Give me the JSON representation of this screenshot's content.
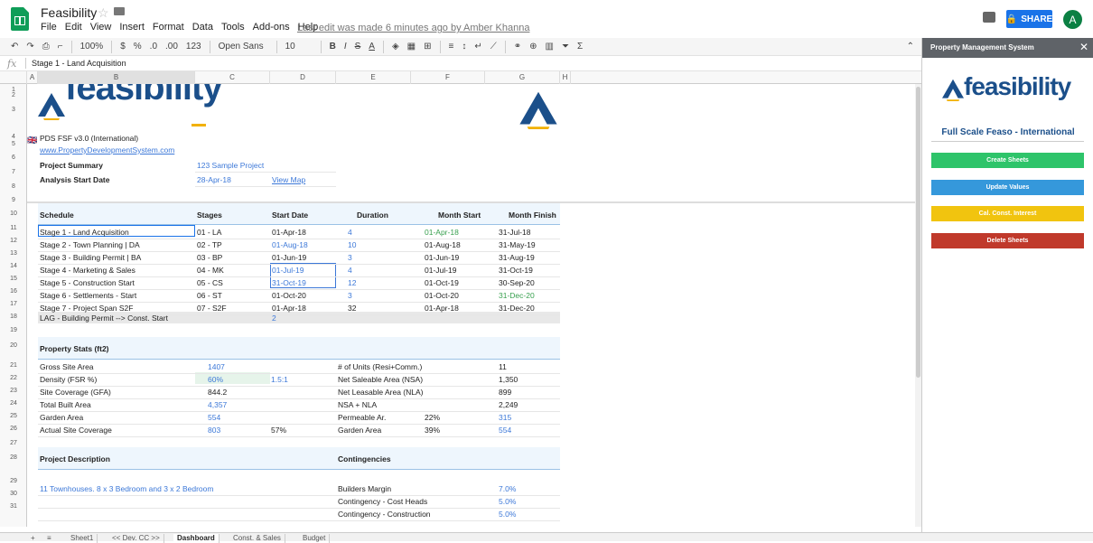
{
  "app": {
    "title": "Feasibility",
    "menu": [
      "File",
      "Edit",
      "View",
      "Insert",
      "Format",
      "Data",
      "Tools",
      "Add-ons",
      "Help"
    ],
    "last_edit": "Last edit was made 6 minutes ago by Amber Khanna",
    "share_label": "SHARE",
    "avatar_initial": "A"
  },
  "toolbar": {
    "zoom": "100%",
    "currency": "$",
    "percent": "%",
    "dec_less": ".0",
    "dec_more": ".00",
    "format_more": "123",
    "font": "Open Sans",
    "size": "10",
    "bold": "B",
    "italic": "I",
    "strike": "S",
    "text_color": "A"
  },
  "formula": {
    "fx": "fx",
    "value": "Stage 1 - Land Acquisition"
  },
  "columns": [
    "A",
    "B",
    "C",
    "D",
    "E",
    "F",
    "G",
    "H"
  ],
  "rows": [
    "1",
    "2",
    "3",
    "4",
    "5",
    "6",
    "7",
    "8",
    "9",
    "10",
    "11",
    "12",
    "13",
    "14",
    "15",
    "16",
    "17",
    "18",
    "19",
    "20",
    "21",
    "22",
    "23",
    "24",
    "25",
    "26",
    "27",
    "28",
    "29",
    "30",
    "31"
  ],
  "sheet": {
    "brand": "feasibility",
    "version": "PDS FSF v3.0 (International)",
    "website": "www.PropertyDevelopmentSystem.com",
    "summary_label": "Project Summary",
    "summary_value": "123 Sample Project",
    "start_label": "Analysis Start Date",
    "start_value": "28-Apr-18",
    "view_map": "View Map",
    "schedule_headers": [
      "Schedule",
      "Stages",
      "Start Date",
      "Duration",
      "Month Start",
      "Month Finish"
    ],
    "schedule": [
      {
        "name": "Stage 1 - Land Acquisition",
        "stage": "01 - LA",
        "start": "01-Apr-18",
        "dur": "4",
        "mstart": "01-Apr-18",
        "mfinish": "31-Jul-18"
      },
      {
        "name": "Stage 2 - Town Planning | DA",
        "stage": "02 - TP",
        "start": "01-Aug-18",
        "dur": "10",
        "mstart": "01-Aug-18",
        "mfinish": "31-May-19"
      },
      {
        "name": "Stage 3 - Building Permit | BA",
        "stage": "03 - BP",
        "start": "01-Jun-19",
        "dur": "3",
        "mstart": "01-Jun-19",
        "mfinish": "31-Aug-19"
      },
      {
        "name": "Stage 4 - Marketing & Sales",
        "stage": "04 - MK",
        "start": "01-Jul-19",
        "dur": "4",
        "mstart": "01-Jul-19",
        "mfinish": "31-Oct-19"
      },
      {
        "name": "Stage 5 - Construction Start",
        "stage": "05 - CS",
        "start": "31-Oct-19",
        "dur": "12",
        "mstart": "01-Oct-19",
        "mfinish": "30-Sep-20"
      },
      {
        "name": "Stage 6 - Settlements - Start",
        "stage": "06 - ST",
        "start": "01-Oct-20",
        "dur": "3",
        "mstart": "01-Oct-20",
        "mfinish": "31-Dec-20"
      },
      {
        "name": "Stage 7 - Project Span S2F",
        "stage": "07 - S2F",
        "start": "01-Apr-18",
        "dur": "32",
        "mstart": "01-Apr-18",
        "mfinish": "31-Dec-20"
      }
    ],
    "lag_label": "LAG - Building Permit --> Const. Start",
    "lag_value": "2",
    "stats_title": "Property Stats (ft2)",
    "stats_left": [
      {
        "label": "Gross Site Area",
        "v1": "1407",
        "v2": ""
      },
      {
        "label": "Density (FSR %)",
        "v1": "60%",
        "v2": "1.5:1"
      },
      {
        "label": "Site Coverage (GFA)",
        "v1": "844.2",
        "v2": ""
      },
      {
        "label": "Total Built Area",
        "v1": "4,357",
        "v2": ""
      },
      {
        "label": "Garden Area",
        "v1": "554",
        "v2": ""
      },
      {
        "label": "Actual Site Coverage",
        "v1": "803",
        "v2": "57%"
      }
    ],
    "stats_right": [
      {
        "label": "# of Units (Resi+Comm.)",
        "v1": "",
        "v2": "11"
      },
      {
        "label": "Net Saleable Area (NSA)",
        "v1": "",
        "v2": "1,350"
      },
      {
        "label": "Net Leasable Area (NLA)",
        "v1": "",
        "v2": "899"
      },
      {
        "label": "NSA + NLA",
        "v1": "",
        "v2": "2,249"
      },
      {
        "label": "Permeable Ar.",
        "v1": "22%",
        "v2": "315"
      },
      {
        "label": "Garden Area",
        "v1": "39%",
        "v2": "554"
      }
    ],
    "desc_title": "Project Description",
    "desc_value": "11 Townhouses. 8 x 3 Bedroom and 3 x 2 Bedroom",
    "cont_title": "Contingencies",
    "contingencies": [
      {
        "label": "Builders Margin",
        "value": "7.0%"
      },
      {
        "label": "Contingency - Cost Heads",
        "value": "5.0%"
      },
      {
        "label": "Contingency - Construction",
        "value": "5.0%"
      }
    ]
  },
  "tabs": [
    "Sheet1",
    "<< Dev. CC >>",
    "Dashboard",
    "Const. & Sales",
    "Budget"
  ],
  "panel": {
    "title": "Property Management System",
    "brand": "feasibility",
    "subtitle": "Full Scale Feaso - International",
    "buttons": [
      "Create Sheets",
      "Update Values",
      "Cal. Const. Interest",
      "Delete Sheets"
    ]
  },
  "colors": {
    "green": "#2ec46a",
    "blue": "#3598db",
    "yellow": "#f1c40f",
    "red": "#c0392b",
    "brand": "#1b4f8a",
    "accent": "#f2b100"
  }
}
